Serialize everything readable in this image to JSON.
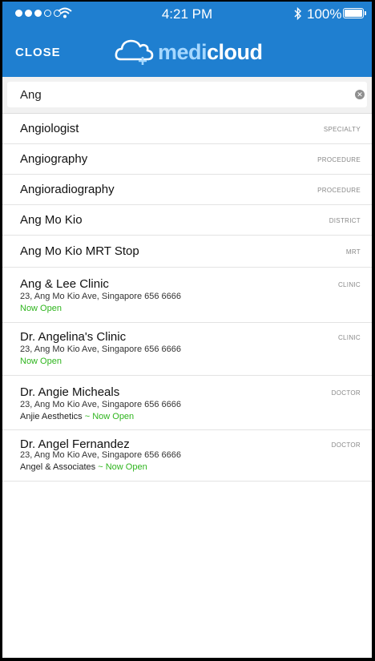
{
  "status_bar": {
    "time": "4:21 PM",
    "battery": "100%"
  },
  "header": {
    "close_label": "CLOSE",
    "logo_medi": "medi",
    "logo_cloud": "cloud",
    "logo_icon": "cloud-plus-icon",
    "color": "#1f7fd0"
  },
  "search": {
    "value": "Ang",
    "clear_icon": "clear-icon"
  },
  "results": [
    {
      "title": "Angiologist",
      "type": "SPECIALTY"
    },
    {
      "title": "Angiography",
      "type": "PROCEDURE"
    },
    {
      "title": "Angioradiography",
      "type": "PROCEDURE"
    },
    {
      "title": "Ang Mo Kio",
      "type": "DISTRICT"
    },
    {
      "title": "Ang Mo Kio MRT Stop",
      "type": "MRT"
    },
    {
      "title": "Ang & Lee Clinic",
      "type": "CLINIC",
      "address": "23, Ang Mo Kio Ave, Singapore 656 6666",
      "sub_prefix": "",
      "status": "Now Open"
    },
    {
      "title": "Dr. Angelina's Clinic",
      "type": "CLINIC",
      "address": "23, Ang Mo Kio Ave, Singapore 656 6666",
      "sub_prefix": "",
      "status": "Now Open"
    },
    {
      "title": "Dr. Angie Micheals",
      "type": "DOCTOR",
      "address": "23, Ang Mo Kio Ave, Singapore 656 6666",
      "sub_prefix": "Anjie Aesthetics",
      "status": "~ Now Open"
    },
    {
      "title": "Dr. Angel Fernandez",
      "type": "DOCTOR",
      "address": "23, Ang Mo Kio Ave, Singapore 656 6666",
      "sub_prefix": "Angel & Associates",
      "status": "~ Now Open"
    }
  ]
}
